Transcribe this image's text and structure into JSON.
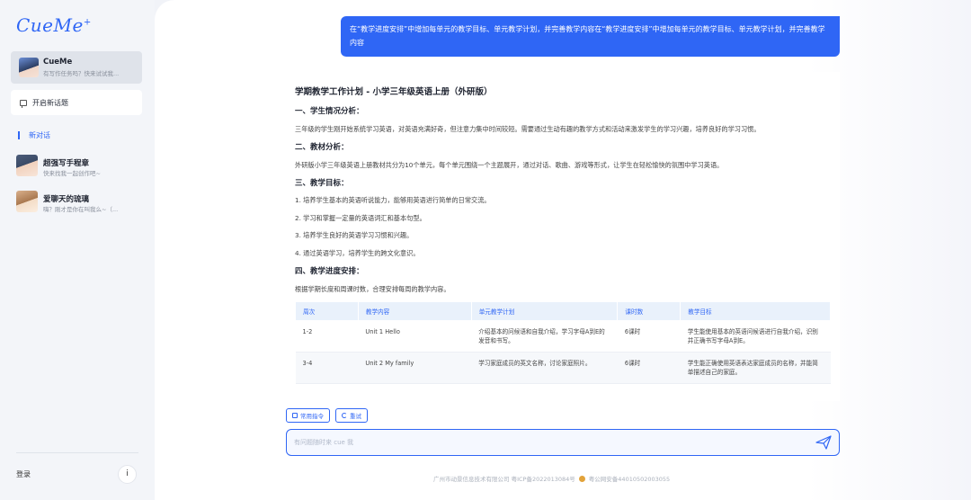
{
  "sidebar": {
    "logo": "CueMe",
    "logo_mark": "+",
    "bots": [
      {
        "name": "CueMe",
        "sub": "有写作任务吗？快来试试我..."
      },
      {
        "name": "超强写手程章",
        "sub": "快来找我一起创作吧~"
      },
      {
        "name": "爱聊天的琉璃",
        "sub": "嗨？刚才是你在叫我么~（..."
      }
    ],
    "new_topic": "开启新话题",
    "new_chat": "新对话",
    "login": "登录",
    "info_icon": "i"
  },
  "chat": {
    "user_message": "在“教学进度安排”中增加每单元的教学目标、单元教学计划，并完善教学内容在“教学进度安排”中增加每单元的教学目标、单元教学计划，并完善教学内容",
    "answer": {
      "title": "学期教学工作计划 - 小学三年级英语上册（外研版）",
      "sections": [
        {
          "heading": "一、学生情况分析：",
          "text": "三年级的学生刚开始系统学习英语，对英语充满好奇，但注意力集中时间较短。需要通过生动有趣的教学方式和活动来激发学生的学习兴趣，培养良好的学习习惯。"
        },
        {
          "heading": "二、教材分析：",
          "text": "外研版小学三年级英语上册教材共分为10个单元，每个单元围绕一个主题展开，通过对话、歌曲、游戏等形式，让学生在轻松愉快的氛围中学习英语。"
        },
        {
          "heading": "三、教学目标：",
          "items": [
            "1. 培养学生基本的英语听说能力，能够用英语进行简单的日常交流。",
            "2. 学习和掌握一定量的英语词汇和基本句型。",
            "3. 培养学生良好的英语学习习惯和兴趣。",
            "4. 通过英语学习，培养学生的跨文化意识。"
          ]
        },
        {
          "heading": "四、教学进度安排：",
          "text": "根据学期长度和周课时数，合理安排每周的教学内容。"
        }
      ],
      "table": {
        "headers": [
          "周次",
          "教学内容",
          "单元教学计划",
          "课时数",
          "教学目标"
        ],
        "rows": [
          [
            "1-2",
            "Unit 1 Hello",
            "介绍基本的问候语和自我介绍，学习字母A到E的发音和书写。",
            "6课时",
            "学生能使用基本的英语问候语进行自我介绍，识别并正确书写字母A到E。"
          ],
          [
            "3-4",
            "Unit 2 My family",
            "学习家庭成员的英文名称，讨论家庭照片。",
            "6课时",
            "学生能正确使用英语表达家庭成员的名称，并能简单描述自己的家庭。"
          ]
        ]
      }
    },
    "chips": {
      "common": "常用指令",
      "retry": "重试"
    },
    "input_placeholder": "有问题随时来 cue 我"
  },
  "footer": {
    "company": "广州市动景信息技术有限公司 粤ICP备2022013084号",
    "police": "粤公网安备44010502003055"
  },
  "colors": {
    "accent": "#2f66f5",
    "table_header_bg": "#e9f1fb"
  },
  "icons": [
    "topic-icon",
    "info-icon",
    "command-icon",
    "refresh-icon",
    "send-icon",
    "police-badge-icon"
  ]
}
